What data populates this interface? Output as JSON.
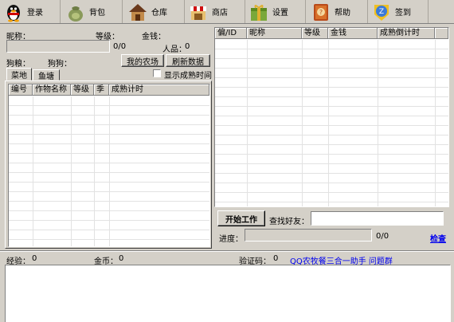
{
  "toolbar": {
    "items": [
      {
        "label": "登录",
        "icon": "penguin-icon"
      },
      {
        "label": "背包",
        "icon": "bag-icon"
      },
      {
        "label": "仓库",
        "icon": "house-icon"
      },
      {
        "label": "商店",
        "icon": "shop-icon"
      },
      {
        "label": "设置",
        "icon": "gift-box-icon"
      },
      {
        "label": "帮助",
        "icon": "help-book-icon"
      },
      {
        "label": "签到",
        "icon": "checkin-icon"
      }
    ]
  },
  "left": {
    "nickname_label": "昵称：",
    "level_label": "等级：",
    "money_label": "金钱：",
    "exp_progress_text": "0/0",
    "renpin_label": "人品：",
    "renpin_value": "0",
    "dog_food_label": "狗粮：",
    "dog_label": "狗狗：",
    "my_farm_button": "我的农场",
    "refresh_button": "刷新数据",
    "show_ripe_time_label": "显示成熟时间",
    "tabs": [
      "菜地",
      "鱼塘"
    ],
    "grid_columns": [
      "编号",
      "作物名称",
      "等级",
      "季",
      "成熟计时"
    ]
  },
  "right": {
    "grid_columns": [
      "偏/ID",
      "昵称",
      "等级",
      "金钱",
      "成熟倒计时"
    ],
    "start_button": "开始工作",
    "find_friend_label": "查找好友：",
    "find_friend_value": "",
    "progress_label": "进度：",
    "progress_text": "0/0",
    "check_link": "检查"
  },
  "status": {
    "exp_label": "经验：",
    "exp_value": "0",
    "coin_label": "金币：",
    "coin_value": "0",
    "verify_label": "验证码：",
    "verify_value": "0",
    "group_link": "QQ农牧餐三合一助手 问题群"
  },
  "log": {
    "text": ""
  }
}
